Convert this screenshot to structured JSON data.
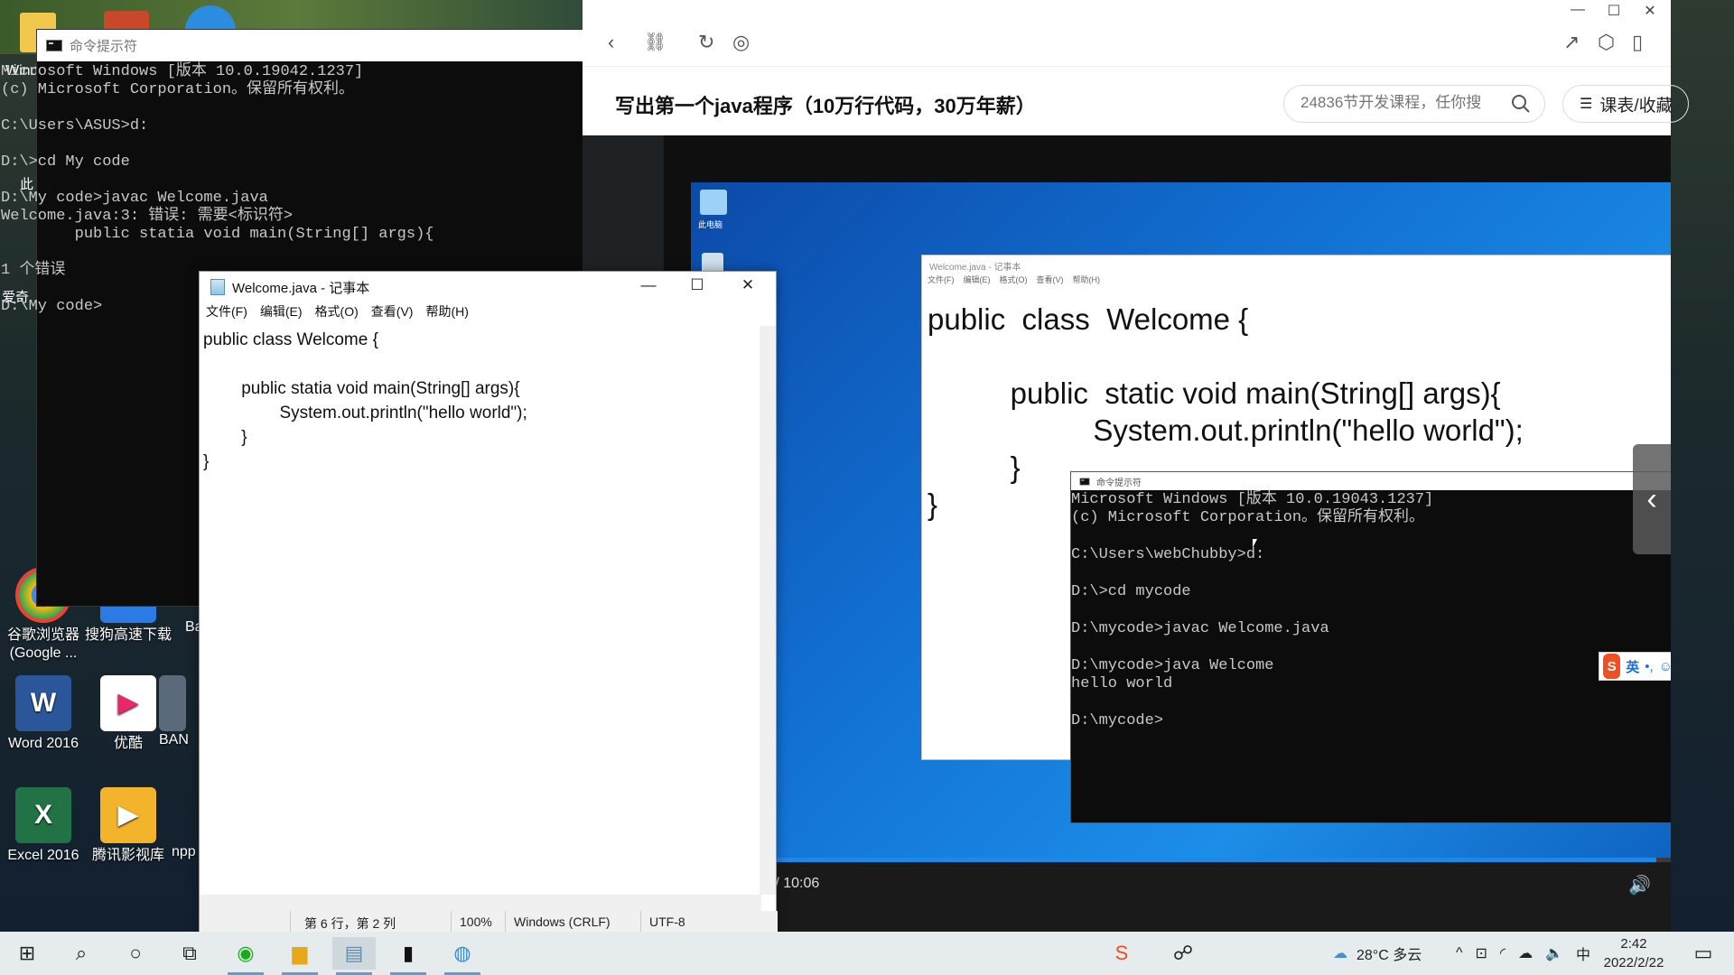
{
  "desktop": {
    "icons": [
      {
        "label": "谷歌浏览器\n(Google ...",
        "color": "#e94335",
        "glyph": "G"
      },
      {
        "label": "搜狗高速下载",
        "color": "#2c7be5",
        "glyph": "↓"
      },
      {
        "label": "Word 2016",
        "color": "#2b579a",
        "glyph": "W"
      },
      {
        "label": "优酷",
        "color": "#1fb5ff",
        "glyph": "▶"
      },
      {
        "label": "Excel 2016",
        "color": "#217346",
        "glyph": "X"
      },
      {
        "label": "腾讯影视库",
        "color": "#f3b42b",
        "glyph": "▶"
      },
      {
        "label": "BAN",
        "color": "#555",
        "glyph": ""
      },
      {
        "label": "npp",
        "color": "#555",
        "glyph": ""
      }
    ],
    "clipped_labels": [
      "Wind",
      "此",
      "爱奇",
      "Ba"
    ]
  },
  "cmd_window": {
    "title": "命令提示符",
    "lines": "Microsoft Windows [版本 10.0.19042.1237]\n(c) Microsoft Corporation。保留所有权利。\n\nC:\\Users\\ASUS>d:\n\nD:\\>cd My code\n\nD:\\My code>javac Welcome.java\nWelcome.java:3: 错误: 需要<标识符>\n        public statia void main(String[] args){\n\n1 个错误\n\nD:\\My code>"
  },
  "browser": {
    "course_title": "写出第一个java程序（10万行代码，30万年薪）",
    "search_placeholder": "24836节开发课程，任你搜",
    "catalog_label": "课表/收藏",
    "window_controls": {
      "minimize": "—",
      "maximize": "☐",
      "close": "✕"
    }
  },
  "video": {
    "notepad_title": "Welcome.java - 记事本",
    "notepad_menu": [
      "文件(F)",
      "编辑(E)",
      "格式(O)",
      "查看(V)",
      "帮助(H)"
    ],
    "code": "public  class  Welcome {\n\n          public  static void main(String[] args){\n                    System.out.println(\"hello world\");\n          }\n}",
    "cmd_title": "命令提示符",
    "cmd_lines": "Microsoft Windows [版本 10.0.19043.1237]\n(c) Microsoft Corporation。保留所有权利。\n\nC:\\Users\\webChubby>d:\n\nD:\\>cd mycode\n\nD:\\mycode>javac Welcome.java\n\nD:\\mycode>java Welcome\nhello world\n\nD:\\mycode>",
    "desktop_icon_label": "此电脑",
    "ime_label": "英",
    "time": "3 / 10:06",
    "progress_fraction": 0.985
  },
  "notepad": {
    "title": "Welcome.java - 记事本",
    "menu": [
      "文件(F)",
      "编辑(E)",
      "格式(O)",
      "查看(V)",
      "帮助(H)"
    ],
    "content": "public class Welcome {\n\n\t\tpublic statia void main(String[] args){\n\t\t\t\tSystem.out.println(\"hello world\");\n\t\t}\n}",
    "status": {
      "position": "第 6 行，第 2 列",
      "zoom": "100%",
      "eol": "Windows (CRLF)",
      "encoding": "UTF-8"
    }
  },
  "taskbar": {
    "weather": "28°C  多云",
    "time": "2:42",
    "date": "2022/2/22",
    "ime": "中"
  }
}
